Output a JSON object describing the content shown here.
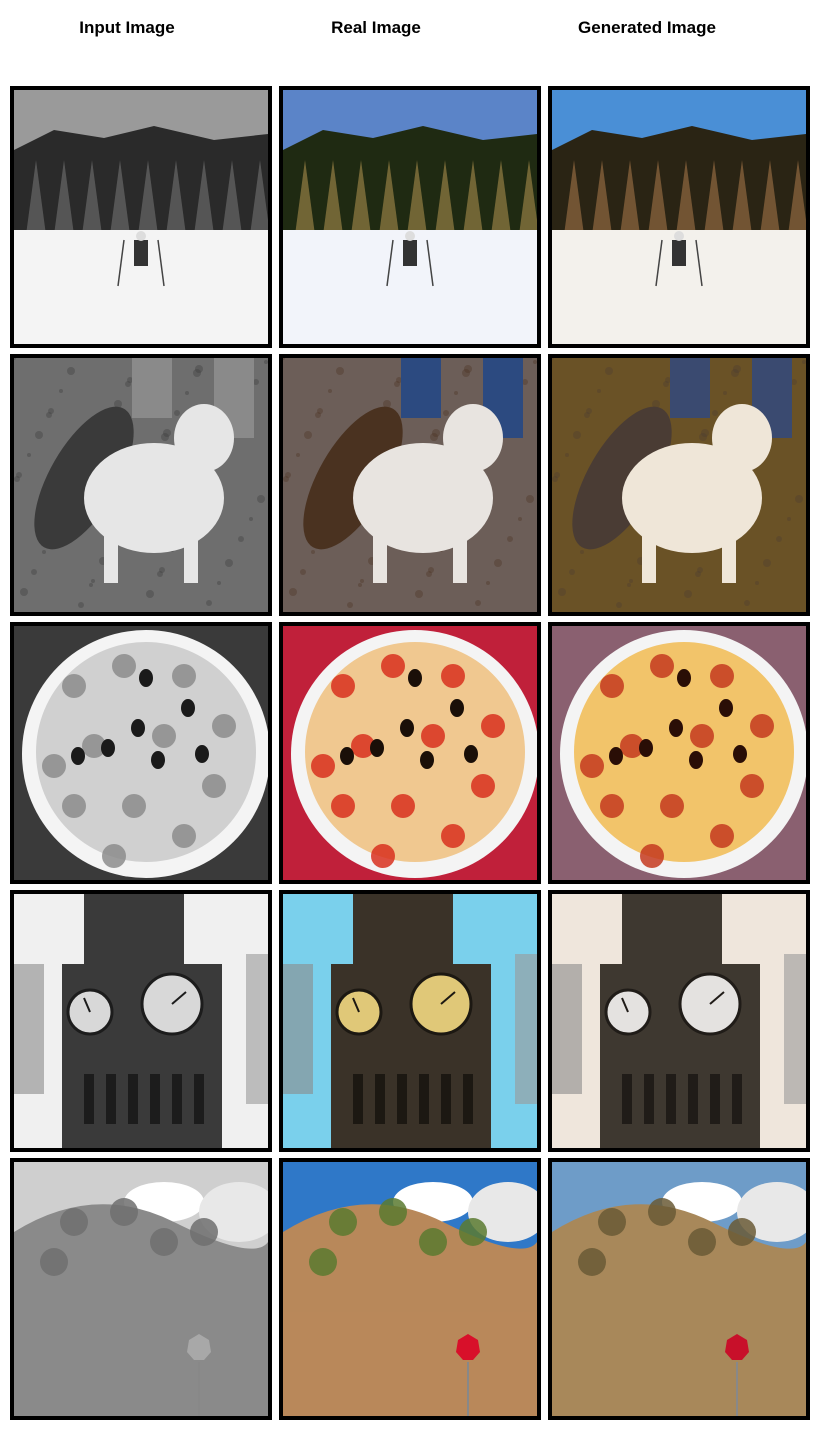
{
  "headers": {
    "input": "Input Image",
    "real": "Real Image",
    "generated": "Generated Image"
  },
  "rows": [
    {
      "scene": "skier-in-snowy-forest",
      "variants": {
        "input": {
          "sky": "#9a9a9a",
          "ground": "#f4f4f4",
          "accent": "#5a5a5a",
          "dark": "#2a2a2a"
        },
        "real": {
          "sky": "#5b84c8",
          "ground": "#f2f4fa",
          "accent": "#7a6b3a",
          "dark": "#1f2a12"
        },
        "generated": {
          "sky": "#4a8fd6",
          "ground": "#f3f1ec",
          "accent": "#7a5a36",
          "dark": "#2a2414"
        }
      }
    },
    {
      "scene": "dog-with-hat-on-gravel",
      "variants": {
        "input": {
          "sky": "#8a8a8a",
          "ground": "#6e6e6e",
          "accent": "#3a3a3a",
          "dark": "#e6e6e6"
        },
        "real": {
          "sky": "#2c4a80",
          "ground": "#6c5e58",
          "accent": "#4a3220",
          "dark": "#e8e4e0"
        },
        "generated": {
          "sky": "#3a4a70",
          "ground": "#6a5226",
          "accent": "#4a3c34",
          "dark": "#efe6d8"
        }
      }
    },
    {
      "scene": "pepperoni-pizza",
      "variants": {
        "input": {
          "sky": "#3a3a3a",
          "ground": "#d0d0d0",
          "accent": "#8c8c8c",
          "dark": "#1a1a1a"
        },
        "real": {
          "sky": "#c0203a",
          "ground": "#f0c890",
          "accent": "#d8301e",
          "dark": "#1a0f08"
        },
        "generated": {
          "sky": "#8a6070",
          "ground": "#f2c46a",
          "accent": "#c43a1e",
          "dark": "#2a0e06"
        }
      }
    },
    {
      "scene": "clock-tower",
      "variants": {
        "input": {
          "sky": "#f0f0f0",
          "ground": "#3a3a3a",
          "accent": "#d8d8d8",
          "dark": "#1c1c1c"
        },
        "real": {
          "sky": "#7ad0ec",
          "ground": "#3a3228",
          "accent": "#e0c878",
          "dark": "#1c1812"
        },
        "generated": {
          "sky": "#efe6dc",
          "ground": "#3e3830",
          "accent": "#e4e2e0",
          "dark": "#201c18"
        }
      }
    },
    {
      "scene": "hillside-with-stop-sign",
      "variants": {
        "input": {
          "sky": "#cfcfcf",
          "ground": "#8a8a8a",
          "accent": "#6e6e6e",
          "dark": "#a8a8a8"
        },
        "real": {
          "sky": "#2f78c8",
          "ground": "#b8885a",
          "accent": "#5a7a30",
          "dark": "#d8102a"
        },
        "generated": {
          "sky": "#6e9cc8",
          "ground": "#a8885a",
          "accent": "#6a5a36",
          "dark": "#c8102a"
        }
      }
    }
  ]
}
